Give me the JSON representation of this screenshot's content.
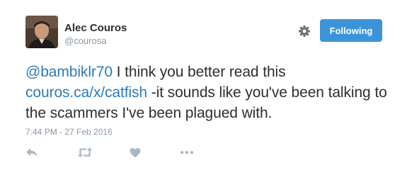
{
  "author": {
    "name": "Alec Couros",
    "handle": "@courosa"
  },
  "follow_button": {
    "label": "Following"
  },
  "tweet": {
    "mention": "@bambiklr70",
    "text_part1": " I think you better read this ",
    "link": "couros.ca/x/catfish",
    "text_part2": " -it sounds like you've been talking to the scammers I've been plagued with.",
    "timestamp": "7:44 PM - 27 Feb 2016"
  },
  "icons": {
    "settings": "gear-icon",
    "reply": "reply-icon",
    "retweet": "retweet-icon",
    "like": "heart-icon",
    "more": "more-icon"
  },
  "colors": {
    "accent": "#3b94d9",
    "link": "#2b7bb9",
    "muted": "#8899a6",
    "icon": "#aab8c2",
    "text": "#292f33"
  }
}
